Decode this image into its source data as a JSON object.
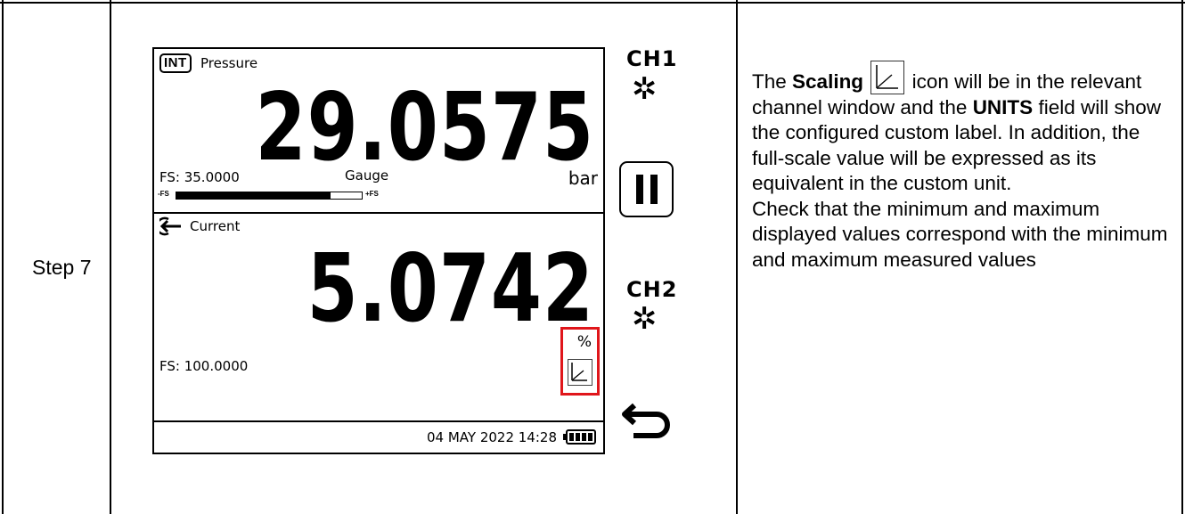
{
  "step": {
    "label": "Step 7"
  },
  "channel1": {
    "badge": "INT",
    "title": "Pressure",
    "reading": "29.0575",
    "fs": "FS: 35.0000",
    "mode": "Gauge",
    "unit": "bar",
    "bar": {
      "min_label": "-FS",
      "max_label": "+FS",
      "fill_fraction": 0.83
    }
  },
  "channel2": {
    "title": "Current",
    "reading": "5.0742",
    "fs": "FS: 100.0000",
    "unit": "%"
  },
  "status_bar": {
    "datetime": "04 MAY 2022 14:28",
    "battery_bars": 4
  },
  "controls": {
    "ch1_label": "CH1",
    "ch2_label": "CH2"
  },
  "icons": {
    "channel1_settings": "gear-icon",
    "channel2_settings": "gear-icon",
    "pause": "pause-icon",
    "back": "back-arrow-icon",
    "input": "input-arrow-icon",
    "scaling": "scaling-icon",
    "battery": "battery-icon"
  },
  "highlight_color": "#e0161b",
  "description": {
    "p1_before": "The ",
    "p1_bold1": "Scaling",
    "p1_after_icon": " icon will be in the relevant channel window and the ",
    "p1_bold2": "UNITS",
    "p1_rest": " field will show the configured custom label. In addition, the full-scale value will be expressed as its equivalent in the custom unit.",
    "p2": "Check that the minimum and maximum displayed values correspond with the minimum and maximum measured values"
  }
}
